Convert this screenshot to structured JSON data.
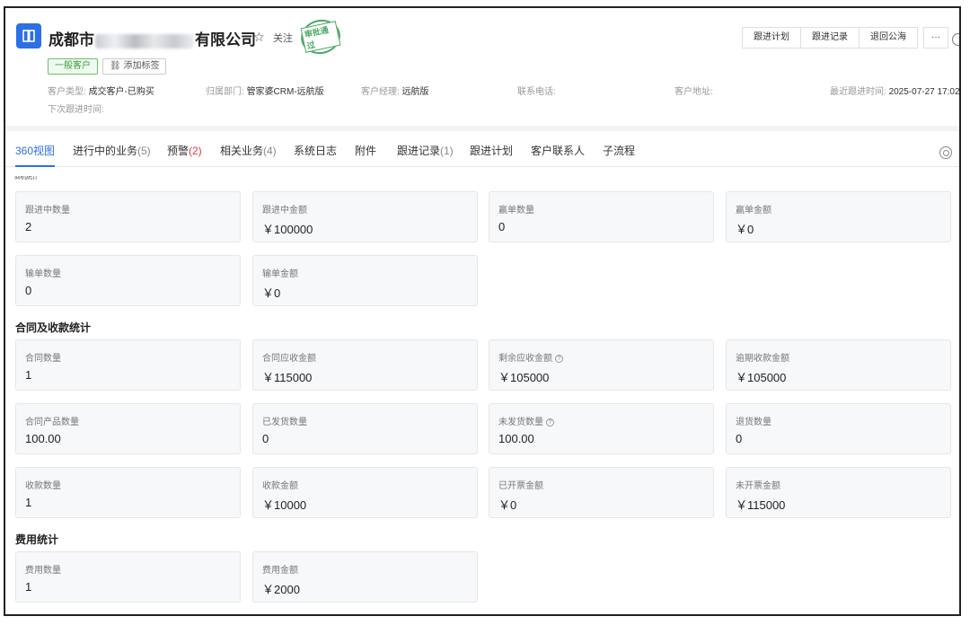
{
  "header": {
    "company_prefix": "成都市",
    "company_suffix": "有限公司",
    "follow_label": "关注",
    "stamp_text": "审批通过",
    "customer_tag": "一般客户",
    "add_tag": "添加标签",
    "meta": {
      "type_label": "客户类型:",
      "type_value": "成交客户-已购买",
      "dept_label": "归属部门:",
      "dept_value": "管家婆CRM-远航版",
      "manager_label": "客户经理:",
      "manager_value": "远航版",
      "phone_label": "联系电话:",
      "address_label": "客户地址:",
      "last_follow_label": "最近跟进时间:",
      "last_follow_value": "2025-07-27 17:02",
      "next_follow_label": "下次跟进时间:"
    },
    "actions": [
      "跟进计划",
      "跟进记录",
      "退回公海",
      "···"
    ]
  },
  "tabs": [
    {
      "label": "360视图",
      "count": ""
    },
    {
      "label": "进行中的业务",
      "count": "(5)"
    },
    {
      "label": "预警",
      "count": "(2)"
    },
    {
      "label": "相关业务",
      "count": "(4)"
    },
    {
      "label": "系统日志",
      "count": ""
    },
    {
      "label": "附件",
      "count": ""
    },
    {
      "label": "跟进记录",
      "count": "(1)"
    },
    {
      "label": "跟进计划",
      "count": ""
    },
    {
      "label": "客户联系人",
      "count": ""
    },
    {
      "label": "子流程",
      "count": ""
    }
  ],
  "sections": {
    "top_cut_title": "商机统计",
    "contract_title": "合同及收款统计",
    "expense_title": "费用统计"
  },
  "cards": {
    "follow_count": {
      "label": "跟进中数量",
      "value": "2"
    },
    "follow_amount": {
      "label": "跟进中金额",
      "value": "￥100000"
    },
    "win_count": {
      "label": "赢单数量",
      "value": "0"
    },
    "win_amount": {
      "label": "赢单金额",
      "value": "￥0"
    },
    "lose_count": {
      "label": "输单数量",
      "value": "0"
    },
    "lose_amount": {
      "label": "输单金额",
      "value": "￥0"
    },
    "contract_count": {
      "label": "合同数量",
      "value": "1"
    },
    "contract_receivable": {
      "label": "合同应收金额",
      "value": "￥115000"
    },
    "remaining_receivable": {
      "label": "剩余应收金额",
      "value": "￥105000"
    },
    "overdue_amount": {
      "label": "逾期收款金额",
      "value": "￥105000"
    },
    "contract_products": {
      "label": "合同产品数量",
      "value": "100.00"
    },
    "shipped_qty": {
      "label": "已发货数量",
      "value": "0"
    },
    "unshipped_qty": {
      "label": "未发货数量",
      "value": "100.00"
    },
    "returned_qty": {
      "label": "退货数量",
      "value": "0"
    },
    "receipt_count": {
      "label": "收款数量",
      "value": "1"
    },
    "receipt_amount": {
      "label": "收款金额",
      "value": "￥10000"
    },
    "invoiced_amount": {
      "label": "已开票金额",
      "value": "￥0"
    },
    "uninvoiced_amount": {
      "label": "未开票金额",
      "value": "￥115000"
    },
    "expense_count": {
      "label": "费用数量",
      "value": "1"
    },
    "expense_amount": {
      "label": "费用金额",
      "value": "￥2000"
    }
  }
}
